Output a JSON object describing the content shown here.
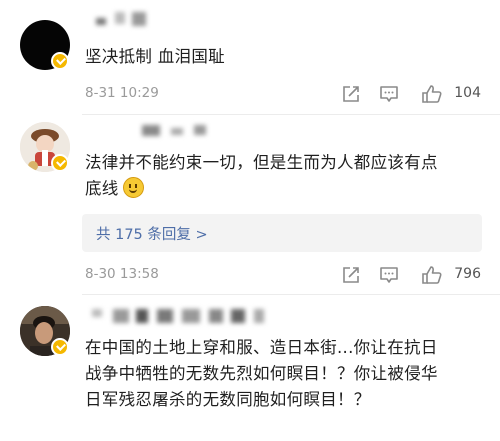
{
  "comments": [
    {
      "text_lines": [
        "坚决抵制  血泪国耻"
      ],
      "time": "8-31 10:29",
      "likes": "104"
    },
    {
      "text_lines": [
        "法律并不能约束一切，但是生而为人都应该有点",
        "底线"
      ],
      "reply_link": "共 175 条回复 >",
      "time": "8-30 13:58",
      "likes": "796"
    },
    {
      "text_lines": [
        "在中国的土地上穿和服、造日本街...你让在抗日",
        "战争中牺牲的无数先烈如何瞑目！？你让被侵华",
        "日军残忍屠杀的无数同胞如何瞑目！？"
      ]
    }
  ],
  "icons": {
    "share": "share-icon",
    "comment": "comment-icon",
    "like": "thumbs-up-icon",
    "emoji": "smile-emoji-icon",
    "verified": "verified-badge-icon"
  },
  "colors": {
    "reply_link": "#4e6ea8",
    "verified_badge": "#f5b800",
    "meta": "#9a9a9a"
  }
}
